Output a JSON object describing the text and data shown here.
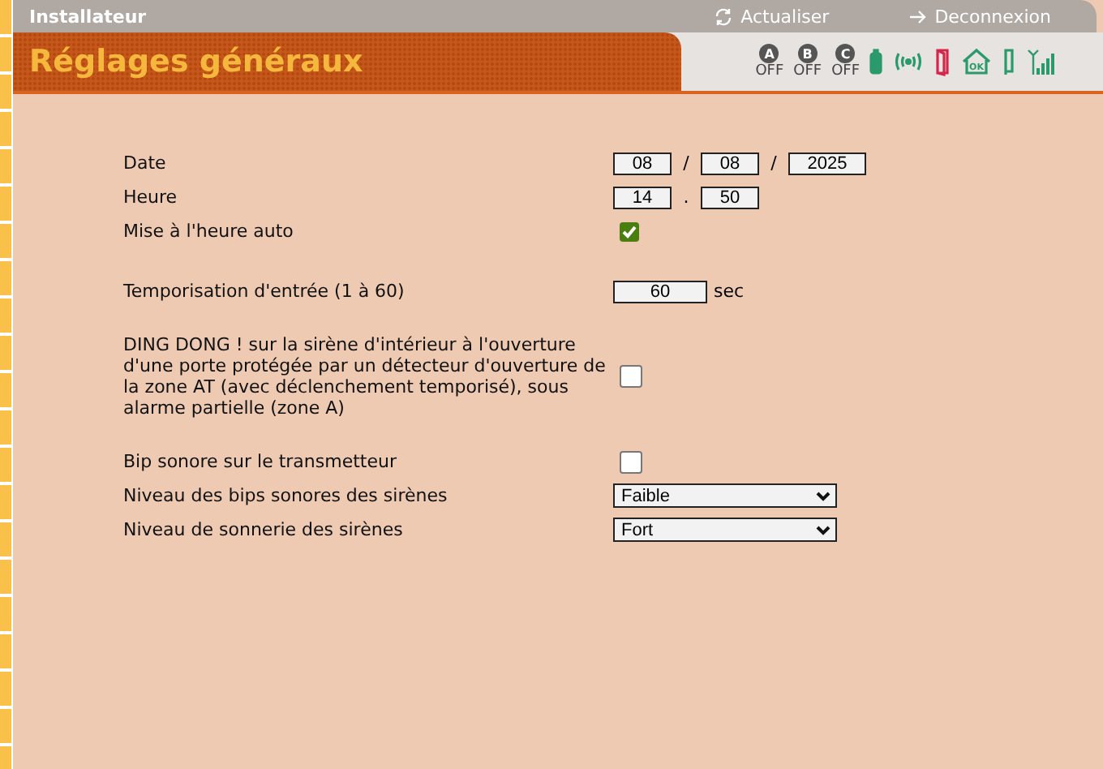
{
  "top_bar": {
    "title": "Installateur",
    "actions": [
      {
        "kind": "refresh",
        "label": "Actualiser"
      },
      {
        "kind": "logout",
        "label": "Deconnexion"
      }
    ]
  },
  "header": {
    "title": "Réglages généraux",
    "zones": [
      {
        "letter": "A",
        "state": "OFF"
      },
      {
        "letter": "B",
        "state": "OFF"
      },
      {
        "letter": "C",
        "state": "OFF"
      }
    ],
    "house_label": "OK"
  },
  "settings": [
    {
      "kind": "date",
      "label": "Date",
      "values": [
        "08",
        "08",
        "2025"
      ],
      "separators": [
        "/",
        "/"
      ]
    },
    {
      "kind": "time",
      "label": "Heure",
      "values": [
        "14",
        "50"
      ],
      "separators": [
        "."
      ]
    },
    {
      "kind": "checkbox",
      "label": "Mise à l'heure auto",
      "checked": true
    },
    {
      "kind": "number",
      "label": "Temporisation d'entrée (1 à 60)",
      "value": "60",
      "unit": "sec"
    },
    {
      "kind": "checkbox",
      "label": "DING DONG ! sur la sirène d'intérieur à l'ouverture d'une porte protégée par un détecteur d'ouverture de la zone AT (avec déclenchement temporisé), sous alarme partielle (zone A)",
      "checked": false
    },
    {
      "kind": "checkbox",
      "label": "Bip sonore sur le transmetteur",
      "checked": false
    },
    {
      "kind": "select",
      "label": "Niveau des bips sonores des sirènes",
      "value": "Faible"
    },
    {
      "kind": "select",
      "label": "Niveau de sonnerie des sirènes",
      "value": "Fort"
    }
  ]
}
